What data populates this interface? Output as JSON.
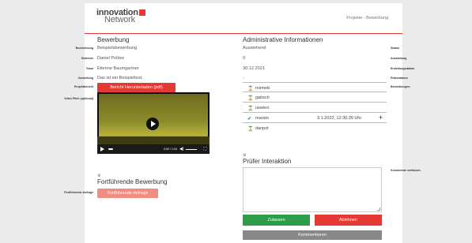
{
  "header": {
    "logo_line1": "innovation",
    "logo_line2": "Network",
    "breadcrumb": "Projekte - Bewerbung"
  },
  "application": {
    "heading": "Bewerbung",
    "fields": [
      {
        "label": "Bezeichnung",
        "value": "Beispielsbewerbung"
      },
      {
        "label": "Betreuer",
        "value": "Daniel Politze"
      },
      {
        "label": "Team",
        "value": "Etienne Baumgartner"
      },
      {
        "label": "Vorstellung",
        "value": "Das ist ein Beispieltext."
      }
    ],
    "report_label": "Projektbericht",
    "report_button": "Bericht Herunterladen (pdf)",
    "video_label": "Video Pitch (optional)",
    "video_time": "0:00 / 1:04"
  },
  "admin": {
    "heading": "Administrative Informationen",
    "fields": [
      {
        "label": "Status",
        "value": "Ausstehend"
      },
      {
        "label": "Auszahlung",
        "value": "0"
      },
      {
        "label": "Erstellungsdatum",
        "value": "30.12.2021"
      },
      {
        "label": "Präsentation",
        "value": "-"
      },
      {
        "label": "Bemerkungen:",
        "value": ""
      }
    ]
  },
  "reviewers": [
    {
      "name": "mirmeb",
      "status": "pending",
      "timestamp": ""
    },
    {
      "name": "gabsch",
      "status": "pending",
      "timestamp": ""
    },
    {
      "name": "uweleo",
      "status": "pending",
      "timestamp": ""
    },
    {
      "name": "marsto",
      "status": "approved",
      "timestamp": "3.1.2022, 12:30:35 Uhr"
    },
    {
      "name": "danpol",
      "status": "pending",
      "timestamp": ""
    }
  ],
  "followup": {
    "heading": "Fortführende Bewerbung",
    "label": "Fortführende Anfrage",
    "button": "Fortführende Anfrage"
  },
  "interaction": {
    "heading": "Prüfer Interaktion",
    "comment_label": "Kommentar verfassen",
    "approve": "Zulassen",
    "reject": "Ablehnen",
    "comment_button": "Kommentieren"
  },
  "colors": {
    "accent": "#e53935",
    "approve": "#2e9d4a",
    "comment": "#888888"
  }
}
